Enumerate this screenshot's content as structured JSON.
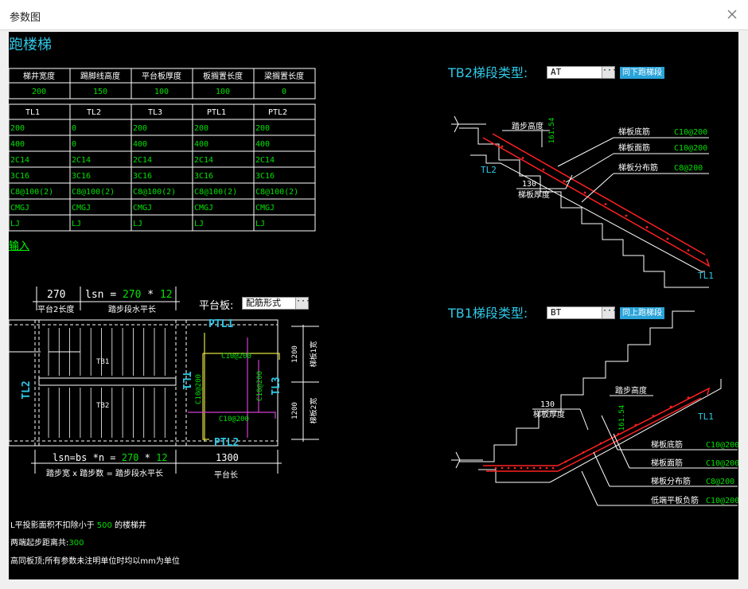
{
  "window": {
    "title": "参数图",
    "close_icon": "close-icon"
  },
  "heading": "跑楼梯",
  "param_table": {
    "headers": [
      "梯井宽度",
      "踢脚线高度",
      "平台板厚度",
      "板搁置长度",
      "梁搁置长度"
    ],
    "values": [
      "200",
      "150",
      "100",
      "100",
      "0"
    ]
  },
  "beam_table": {
    "headers": [
      "TL1",
      "TL2",
      "TL3",
      "PTL1",
      "PTL2"
    ],
    "rows": [
      [
        "200",
        "0",
        "200",
        "200",
        "200"
      ],
      [
        "400",
        "0",
        "400",
        "400",
        "400"
      ],
      [
        "2C14",
        "2C14",
        "2C14",
        "2C14",
        "2C14"
      ],
      [
        "3C16",
        "3C16",
        "3C16",
        "3C16",
        "3C16"
      ],
      [
        "C8@100(2)",
        "C8@100(2)",
        "C8@100(2)",
        "C8@100(2)",
        "C8@100(2)"
      ],
      [
        "CMGJ",
        "CMGJ",
        "CMGJ",
        "CMGJ",
        "CMGJ"
      ],
      [
        "LJ",
        "LJ",
        "LJ",
        "LJ",
        "LJ"
      ]
    ]
  },
  "input_link": "输入",
  "plan": {
    "dim_270": "270",
    "lsn_top": "lsn = 270 * 12",
    "lsn_top_parts": [
      "lsn",
      "=",
      "270",
      "*",
      "12"
    ],
    "label_platform2": "平台2长度",
    "label_step_horiz": "踏步段水平长",
    "platform_board_label": "平台板:",
    "platform_board_value": "配筋形式",
    "tl2": "TL2",
    "tl1": "TL1",
    "tl3": "TL3",
    "ptl1": "PTL1",
    "ptl2": "PTL2",
    "tb1": "TB1",
    "tb2": "TB2",
    "c10_top": "C10@200",
    "c10_bottom": "C10@200",
    "c10_left": "C10@200",
    "c10_right": "C10@200",
    "dim_1200_a": "1200",
    "dim_1200_b": "1200",
    "w1": "梯板1宽",
    "w2": "梯板2宽",
    "lsn_bottom_parts": [
      "lsn=bs",
      "*n",
      "=",
      "270",
      "*",
      "12"
    ],
    "dim_1300": "1300",
    "label_bottom": "踏步宽 x 踏步数 = 踏步段水平长",
    "label_platform_len": "平台长"
  },
  "notes": {
    "line1_a": "L平投影面积不扣除小于",
    "line1_val": "500",
    "line1_b": "的楼梯井",
    "line2_a": "两端起步距离共:",
    "line2_val": "300",
    "line3": "高同板顶;所有参数未注明单位时均以mm为单位"
  },
  "tb2": {
    "label": "TB2梯段类型:",
    "type_value": "AT",
    "button": "同下跑梯段",
    "step_height": "踏步高度",
    "dim_161": "161.54",
    "thickness_val": "130",
    "thickness_label": "梯板厚度",
    "tl2": "TL2",
    "tl1": "TL1",
    "callouts": [
      {
        "label": "梯板底筋",
        "value": "C10@200"
      },
      {
        "label": "梯板面筋",
        "value": "C10@200"
      },
      {
        "label": "梯板分布筋",
        "value": "C8@200"
      }
    ]
  },
  "tb1": {
    "label": "TB1梯段类型:",
    "type_value": "BT",
    "button": "同上跑梯段",
    "step_height": "踏步高度",
    "dim_161": "161.54",
    "thickness_val": "130",
    "thickness_label": "梯板厚度",
    "tl1": "TL1",
    "callouts": [
      {
        "label": "梯板底筋",
        "value": "C10@200"
      },
      {
        "label": "梯板面筋",
        "value": "C10@200"
      },
      {
        "label": "梯板分布筋",
        "value": "C8@200"
      },
      {
        "label": "低端平板负筋",
        "value": "C10@200"
      }
    ]
  },
  "colors": {
    "cyan": "#2ec8e6",
    "green": "#00e000",
    "red": "#ff2020",
    "magenta": "#d040d0",
    "yellow": "#e0e040"
  }
}
